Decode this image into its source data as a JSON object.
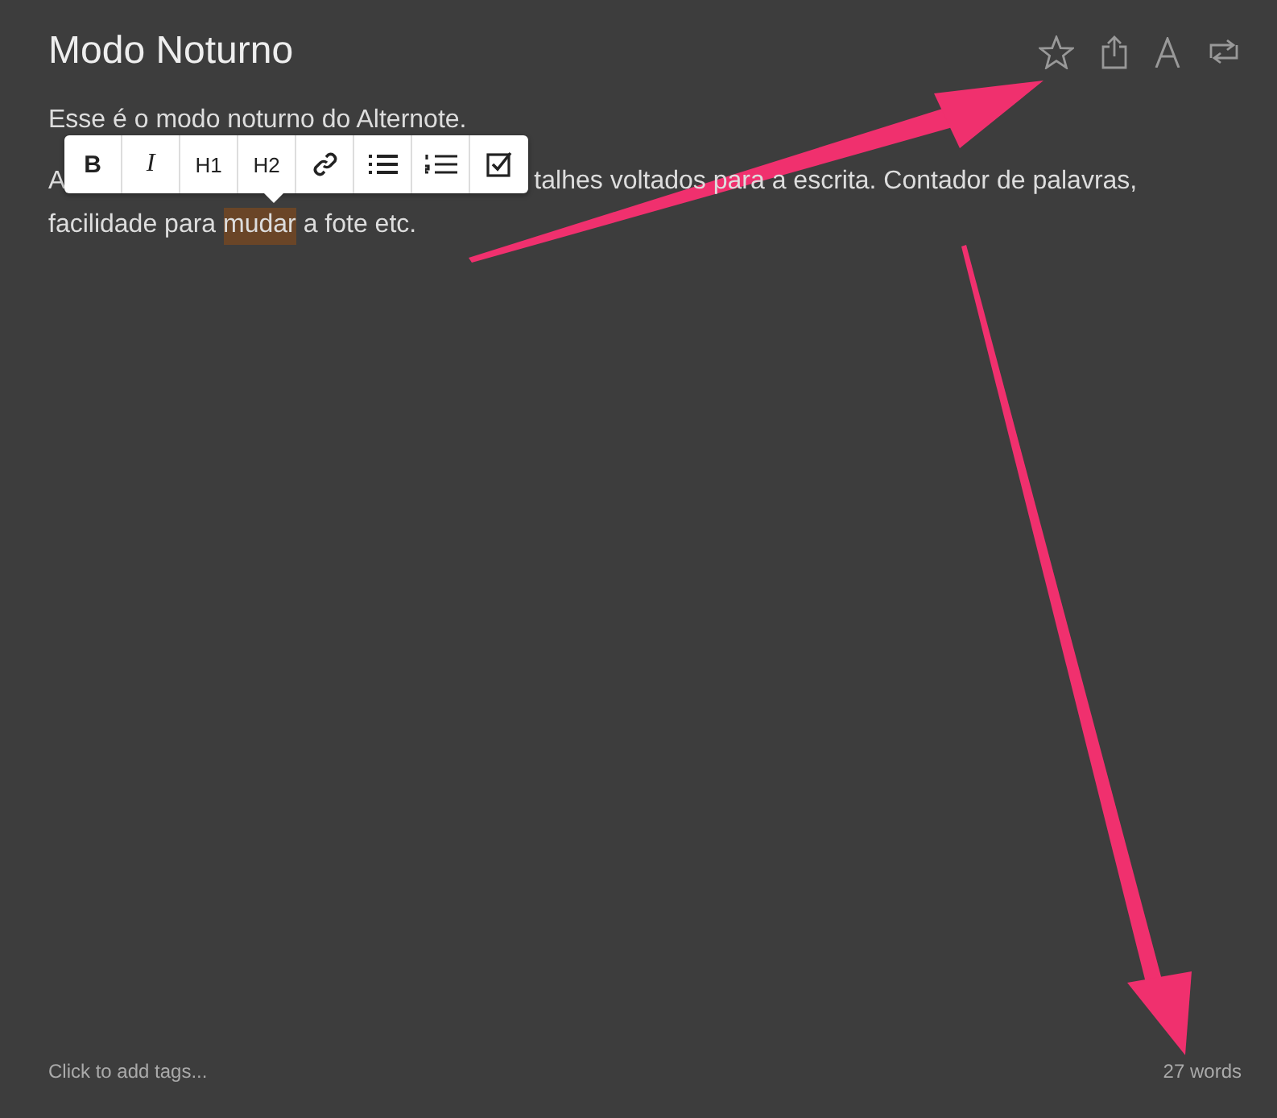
{
  "note": {
    "title": "Modo Noturno",
    "header_icons": [
      {
        "kind": "star"
      },
      {
        "kind": "share"
      },
      {
        "kind": "font"
      },
      {
        "kind": "fullscreen"
      }
    ],
    "paragraph_1": "Esse é o modo noturno do Alternote.",
    "paragraph_2_lines": [
      [
        {
          "text": "A",
          "highlighted": false
        },
        {
          "text": "talhes voltados para a escrita. Contador de palavras,",
          "highlighted": false
        }
      ],
      [
        {
          "text": "facilidade para ",
          "highlighted": false
        },
        {
          "text": "mudar",
          "highlighted": true
        },
        {
          "text": " a fote etc.",
          "highlighted": false
        }
      ]
    ],
    "format_toolbar": [
      {
        "kind": "bold",
        "label": "B"
      },
      {
        "kind": "italic",
        "label": "I"
      },
      {
        "kind": "heading",
        "label": "H1"
      },
      {
        "kind": "heading",
        "label": "H2"
      },
      {
        "kind": "link"
      },
      {
        "kind": "bullet-list"
      },
      {
        "kind": "numbered-list"
      },
      {
        "kind": "checkbox"
      }
    ],
    "tags_placeholder": "Click to add tags...",
    "word_count": "27 words"
  }
}
